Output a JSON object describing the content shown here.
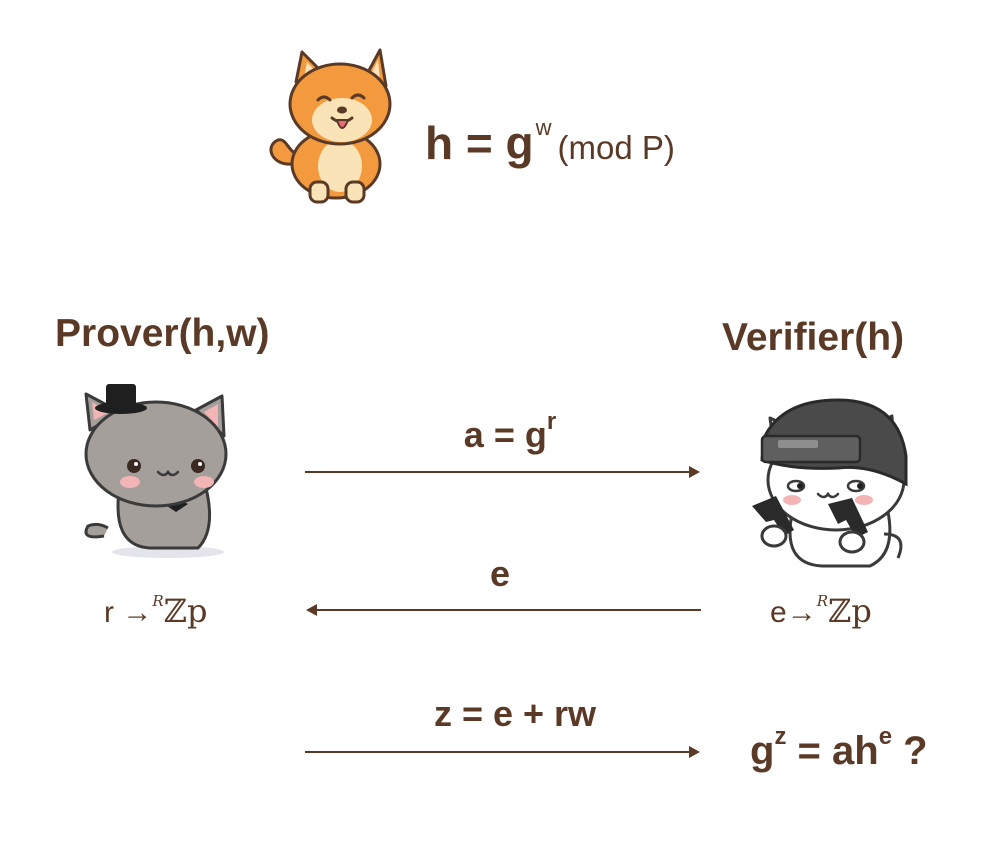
{
  "top_equation": {
    "lhs": "h = g",
    "exp": "w",
    "mod": "(mod P)"
  },
  "prover": {
    "title": "Prover(h,w)",
    "sample_var": "r",
    "sample_arrow": "→",
    "sample_sup": "R",
    "sample_set": "ℤp"
  },
  "verifier": {
    "title": "Verifier(h)",
    "sample_var": "e",
    "sample_arrow": "→",
    "sample_sup": "R",
    "sample_set": "ℤp"
  },
  "messages": {
    "a": {
      "base": "a = g",
      "exp": "r"
    },
    "e": {
      "label": "e"
    },
    "z": {
      "label": "z = e + rw"
    }
  },
  "check": {
    "g": "g",
    "z": "z",
    "mid": " = ah",
    "e": "e",
    "q": " ?"
  },
  "colors": {
    "text": "#5a3a26",
    "arrow": "#5a3a26",
    "shiba": "#f29a3d",
    "cat": "#a49f9b"
  },
  "icons": [
    "shiba-dog-icon",
    "cat-top-hat-icon",
    "cat-helmet-pistols-icon"
  ]
}
